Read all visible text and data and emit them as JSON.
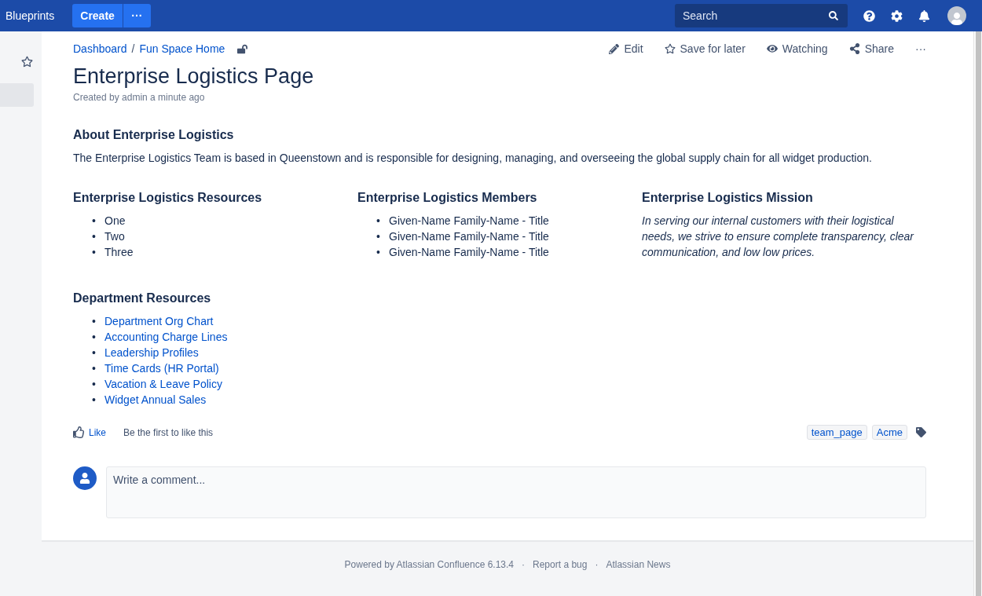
{
  "topbar": {
    "brand": "Blueprints",
    "create": "Create",
    "more": "···",
    "search": {
      "placeholder": "Search"
    }
  },
  "breadcrumbs": [
    {
      "label": "Dashboard"
    },
    {
      "separator": "/",
      "label": "Fun Space Home"
    }
  ],
  "actions": [
    {
      "kind": "edit",
      "label": "Edit"
    },
    {
      "kind": "save",
      "label": "Save for later"
    },
    {
      "kind": "watch",
      "label": "Watching"
    },
    {
      "kind": "share",
      "label": "Share"
    },
    {
      "kind": "more",
      "label": "···"
    }
  ],
  "page": {
    "title": "Enterprise Logistics Page",
    "byline": "Created by admin a minute ago"
  },
  "about": {
    "heading": "About Enterprise Logistics",
    "text": "The Enterprise Logistics Team is based in Queenstown and is responsible for designing, managing, and overseeing the global supply chain for all widget production."
  },
  "columns": [
    {
      "heading": "Enterprise Logistics Resources",
      "kind": "list",
      "items": [
        {
          "bullet": "•",
          "text": "One"
        },
        {
          "bullet": "•",
          "text": "Two"
        },
        {
          "bullet": "•",
          "text": "Three"
        }
      ]
    },
    {
      "heading": "Enterprise Logistics Members",
      "kind": "list",
      "items": [
        {
          "bullet": "•",
          "text": "Given-Name Family-Name - Title"
        },
        {
          "bullet": "•",
          "text": "Given-Name Family-Name - Title"
        },
        {
          "bullet": "•",
          "text": "Given-Name Family-Name - Title"
        }
      ]
    },
    {
      "heading": "Enterprise Logistics Mission",
      "kind": "quote",
      "text": "In serving our internal customers with their logistical needs, we strive to ensure complete transparency, clear communication, and low low prices."
    }
  ],
  "department": {
    "heading": "Department Resources",
    "links": [
      {
        "bullet": "•",
        "text": "Department Org Chart"
      },
      {
        "bullet": "•",
        "text": "Accounting Charge Lines"
      },
      {
        "bullet": "•",
        "text": "Leadership Profiles"
      },
      {
        "bullet": "•",
        "text": "Time Cards (HR Portal)"
      },
      {
        "bullet": "•",
        "text": "Vacation & Leave Policy"
      },
      {
        "bullet": "•",
        "text": "Widget Annual Sales"
      }
    ]
  },
  "like": {
    "label": "Like",
    "text": "Be the first to like this"
  },
  "labels": [
    "team_page",
    "Acme"
  ],
  "comment": {
    "placeholder": "Write a comment..."
  },
  "footer": [
    {
      "text": "Powered by Atlassian Confluence 6.13.4"
    },
    {
      "separator": "·",
      "text": "Report a bug"
    },
    {
      "separator": "·",
      "text": "Atlassian News"
    }
  ]
}
